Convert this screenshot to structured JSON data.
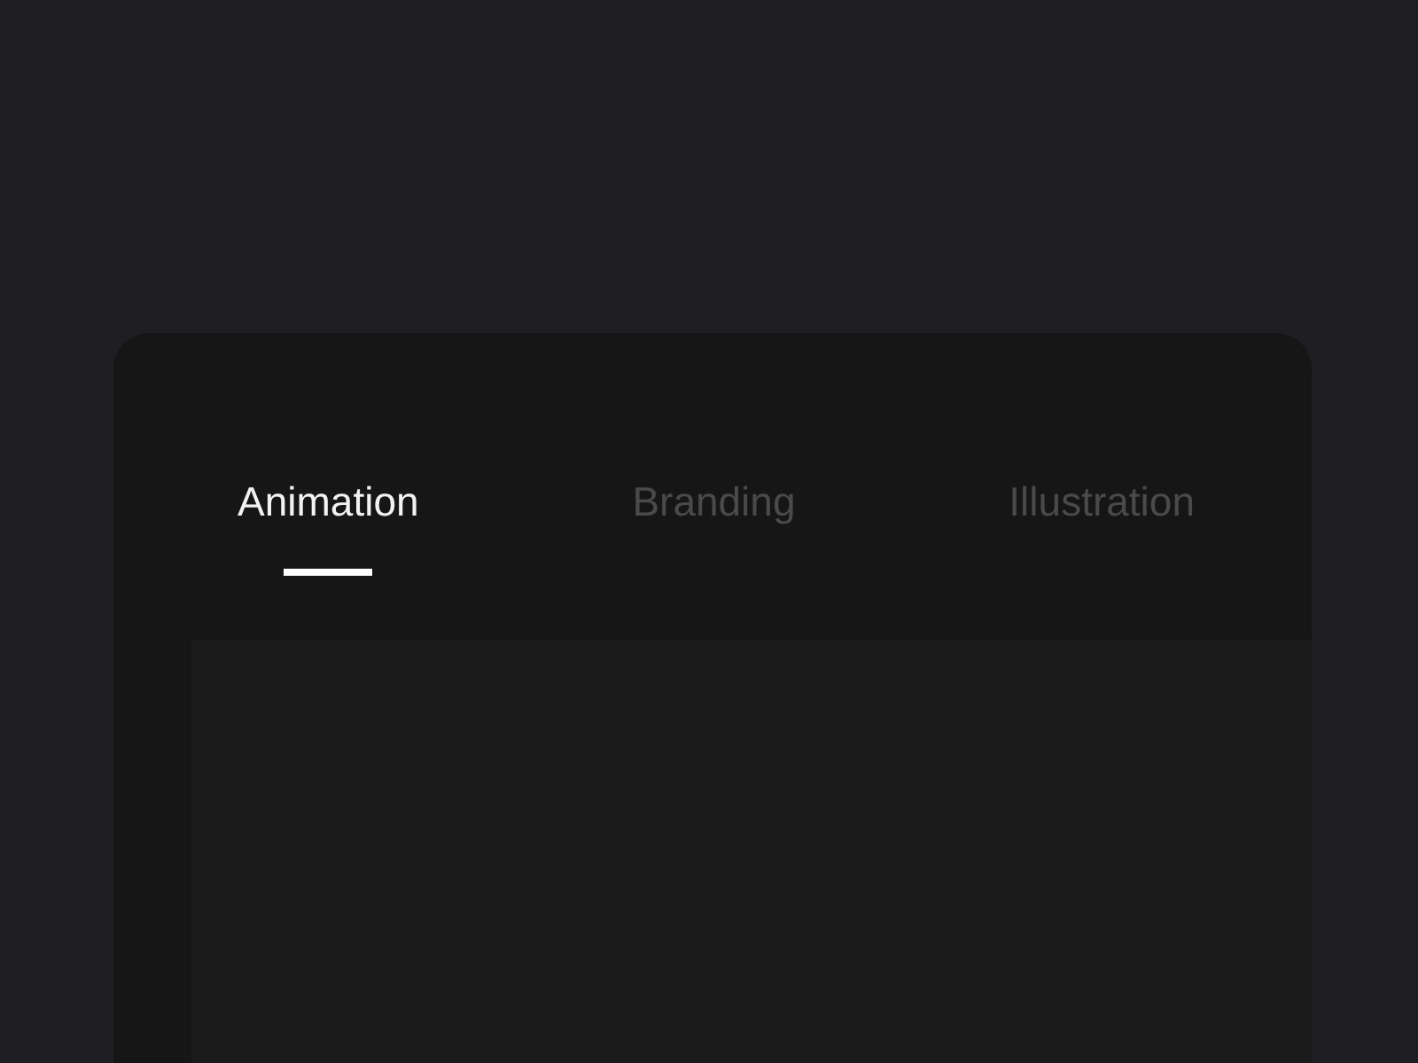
{
  "tabs": [
    {
      "label": "Animation",
      "selected": true
    },
    {
      "label": "Branding",
      "selected": false
    },
    {
      "label": "Illustration",
      "selected": false
    }
  ]
}
